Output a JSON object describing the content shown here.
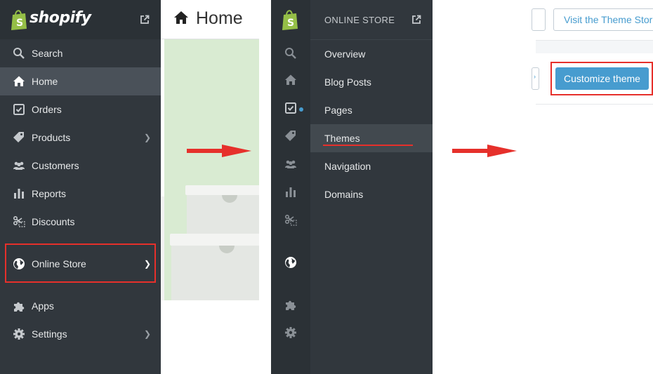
{
  "sidebar": {
    "logo_text": "shopify",
    "items": [
      {
        "label": "Search",
        "icon": "search-icon"
      },
      {
        "label": "Home",
        "icon": "home-icon",
        "active": true
      },
      {
        "label": "Orders",
        "icon": "orders-icon"
      },
      {
        "label": "Products",
        "icon": "tag-icon",
        "chevron": true
      },
      {
        "label": "Customers",
        "icon": "customers-icon"
      },
      {
        "label": "Reports",
        "icon": "reports-icon"
      },
      {
        "label": "Discounts",
        "icon": "discounts-icon"
      },
      {
        "label": "Online Store",
        "icon": "globe-icon",
        "chevron": true,
        "highlighted": true
      },
      {
        "label": "Apps",
        "icon": "apps-icon"
      },
      {
        "label": "Settings",
        "icon": "settings-icon",
        "chevron": true
      }
    ]
  },
  "home_panel": {
    "title": "Home"
  },
  "online_store_panel": {
    "title": "ONLINE STORE",
    "items": [
      {
        "label": "Overview"
      },
      {
        "label": "Blog Posts"
      },
      {
        "label": "Pages"
      },
      {
        "label": "Themes",
        "active": true,
        "underlined": true
      },
      {
        "label": "Navigation"
      },
      {
        "label": "Domains"
      }
    ]
  },
  "themes_panel": {
    "visit_store_label": "Visit the Theme Store",
    "customize_label": "Customize theme"
  },
  "colors": {
    "sidebar_bg": "#31373d",
    "active_bg": "#4a5159",
    "accent_blue": "#479ccf",
    "highlight_red": "#e6302b",
    "brand_green": "#95bf47"
  }
}
